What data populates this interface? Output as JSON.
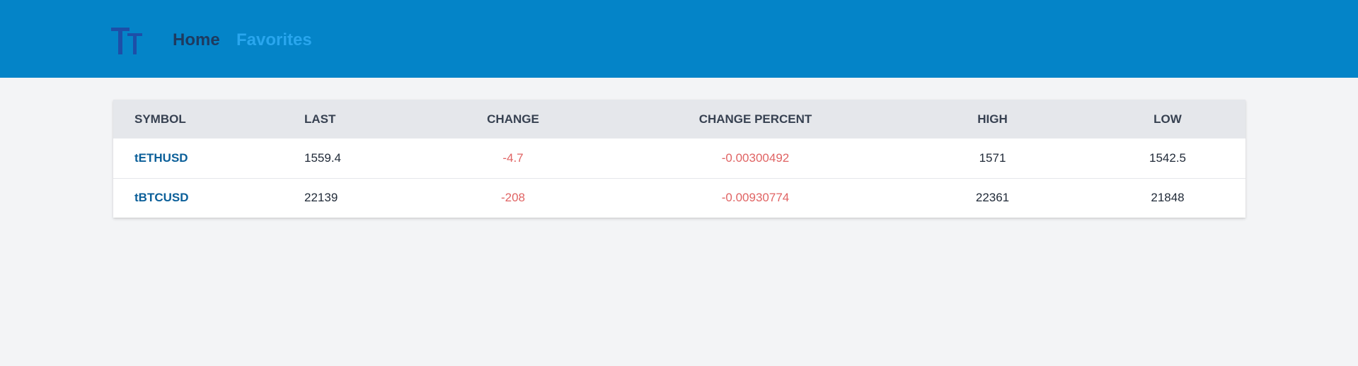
{
  "nav": {
    "logo_text": "TT",
    "home_label": "Home",
    "favorites_label": "Favorites"
  },
  "table": {
    "headers": {
      "symbol": "SYMBOL",
      "last": "LAST",
      "change": "CHANGE",
      "change_percent": "CHANGE PERCENT",
      "high": "HIGH",
      "low": "LOW"
    },
    "rows": [
      {
        "symbol": "tETHUSD",
        "last": "1559.4",
        "change": "-4.7",
        "change_percent": "-0.00300492",
        "high": "1571",
        "low": "1542.5"
      },
      {
        "symbol": "tBTCUSD",
        "last": "22139",
        "change": "-208",
        "change_percent": "-0.00930774",
        "high": "22361",
        "low": "21848"
      }
    ]
  },
  "colors": {
    "header_bg": "#0484c8",
    "logo": "#1d4fa8",
    "nav_home": "#1e3a5f",
    "nav_favorites": "#29a6ee",
    "symbol_link": "#0b5f99",
    "negative": "#e06464"
  }
}
